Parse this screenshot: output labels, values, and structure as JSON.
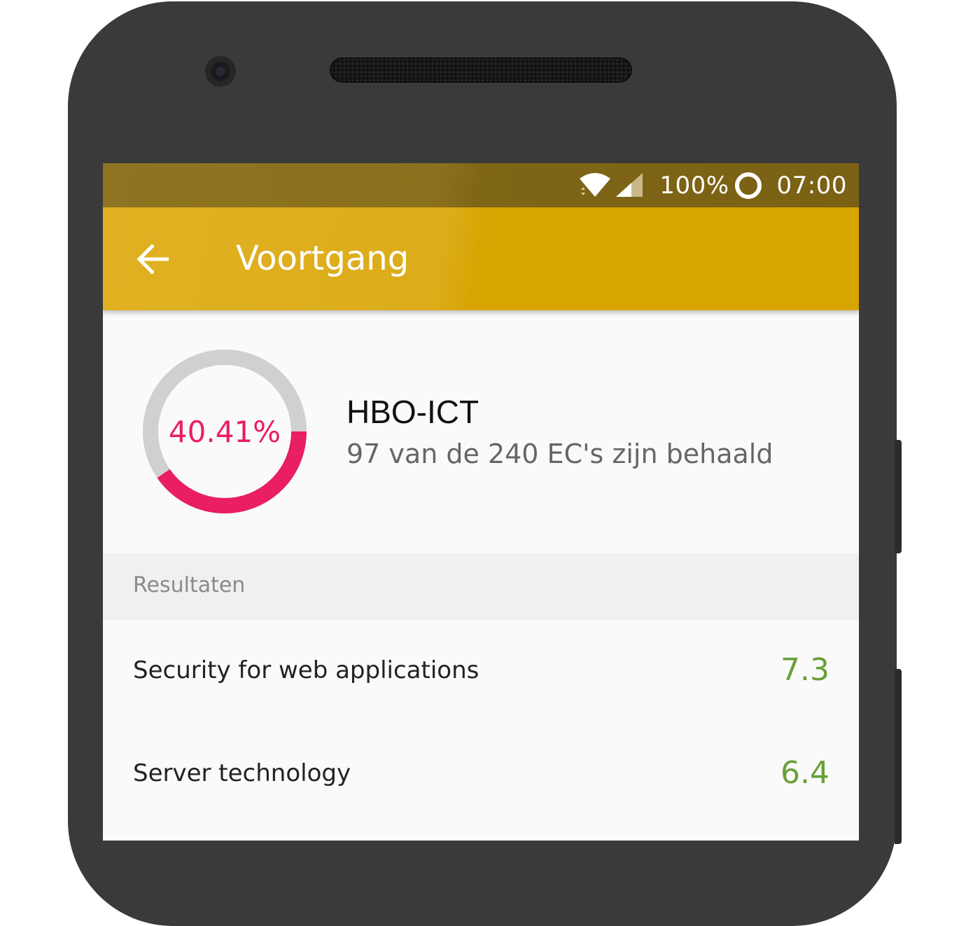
{
  "status_bar": {
    "battery": "100%",
    "time": "07:00",
    "wifi_icon": "wifi-icon",
    "signal_icon": "signal-icon",
    "battery_icon": "battery-ring-icon"
  },
  "app_bar": {
    "title": "Voortgang",
    "back_icon": "arrow-back-icon",
    "color": "#d8a500"
  },
  "summary": {
    "percentage_label": "40.41%",
    "progress_fraction": 0.4041,
    "program": "HBO-ICT",
    "progress_text": "97 van de 240 EC's zijn behaald",
    "ring_color": "#e91e63",
    "track_color": "#d0d0d0"
  },
  "results": {
    "header": "Resultaten",
    "items": [
      {
        "name": "Security for web applications",
        "grade": "7.3"
      },
      {
        "name": "Server technology",
        "grade": "6.4"
      }
    ],
    "grade_color": "#689f38"
  }
}
